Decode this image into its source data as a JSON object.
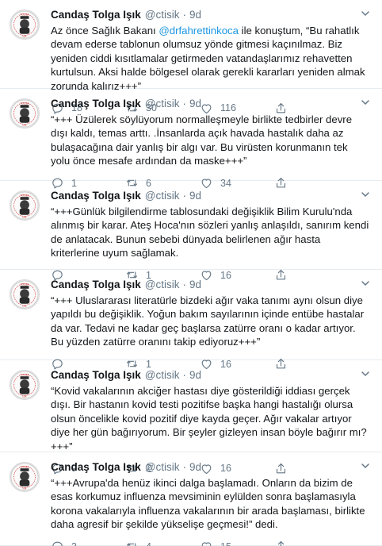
{
  "tweets": [
    {
      "name": "Candaş Tolga Işık",
      "handle": "@ctisik",
      "dot": "·",
      "time": "9d",
      "text_before": "Az önce Sağlık Bakanı ",
      "mention": "@drfahrettinkoca",
      "text_after": " ile konuştum, “Bu rahatlık devam ederse tablonun olumsuz yönde gitmesi kaçınılmaz. Biz yeniden ciddi kısıtlamalar getirmeden vatandaşlarımız rehavetten kurtulsun. Aksi halde bölgesel olarak gerekli kararları yeniden almak zorunda kalırız+++”",
      "replies": "18",
      "retweets": "30",
      "likes": "116"
    },
    {
      "name": "Candaş Tolga Işık",
      "handle": "@ctisik",
      "dot": "·",
      "time": "9d",
      "text": "“+++ Üzülerek söylüyorum normalleşmeyle birlikte tedbirler devre dışı kaldı, temas arttı. .İnsanlarda açık havada hastalık daha az bulaşacağına dair yanlış bir algı var. Bu virüsten korunmanın tek yolu önce mesafe ardından da maske+++”",
      "replies": "1",
      "retweets": "6",
      "likes": "34"
    },
    {
      "name": "Candaş Tolga Işık",
      "handle": "@ctisik",
      "dot": "·",
      "time": "9d",
      "text": "“+++Günlük bilgilendirme tablosundaki değişiklik Bilim Kurulu'nda alınmış bir karar. Ateş Hoca'nın sözleri yanlış anlaşıldı, sanırım kendi de anlatacak. Bunun sebebi dünyada belirlenen ağır hasta kriterlerine uyum sağlamak.",
      "replies": "",
      "retweets": "1",
      "likes": "16"
    },
    {
      "name": "Candaş Tolga Işık",
      "handle": "@ctisik",
      "dot": "·",
      "time": "9d",
      "text": "“+++ Uluslararası literatürle bizdeki ağır vaka tanımı aynı olsun diye yapıldı bu değişiklik. Yoğun bakım sayılarının içinde entübe hastalar da var. Tedavi ne kadar geç başlarsa zatürre oranı o kadar artıyor. Bu yüzden zatürre oranını takip ediyoruz+++”",
      "replies": "",
      "retweets": "1",
      "likes": "16"
    },
    {
      "name": "Candaş Tolga Işık",
      "handle": "@ctisik",
      "dot": "·",
      "time": "9d",
      "text": "“Kovid vakalarının akciğer hastası diye gösterildiği iddiası gerçek dışı. Bir hastanın kovid testi pozitifse başka hangi hastalığı olursa olsun öncelikle kovid pozitif diye kayda geçer. Ağır vakalar artıyor diye her gün bağırıyorum. Bir şeyler gizleyen insan böyle bağırır mı?+++”",
      "replies": "9",
      "retweets": "2",
      "likes": "16"
    },
    {
      "name": "Candaş Tolga Işık",
      "handle": "@ctisik",
      "dot": "·",
      "time": "9d",
      "text": "“+++Avrupa'da henüz ikinci dalga başlamadı. Onların da bizim de esas korkumuz influenza mevsiminin eylülden sonra başlamasıyla korona vakalarıyla influenza vakalarının bir arada başlaması, birlikte daha agresif bir şekilde yükselişe geçmesi!” dedi.",
      "replies": "3",
      "retweets": "4",
      "likes": "15"
    }
  ],
  "colors": {
    "text": "#14171a",
    "muted": "#657786",
    "link": "#1b95e0",
    "divider": "#e6ecf0"
  },
  "icons": [
    "reply-icon",
    "retweet-icon",
    "like-icon",
    "share-icon",
    "caret-down-icon",
    "avatar"
  ]
}
